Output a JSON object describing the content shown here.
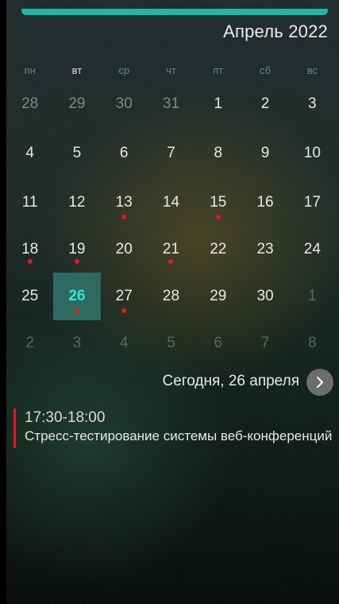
{
  "header": {
    "month_title": "Апрель 2022"
  },
  "accent_color": "#1fb8a8",
  "event_color": "#e01b22",
  "weekdays": [
    "пн",
    "вт",
    "ср",
    "чт",
    "пт",
    "сб",
    "вс"
  ],
  "weeks": [
    [
      {
        "day": "28",
        "state": "muted"
      },
      {
        "day": "29",
        "state": "muted"
      },
      {
        "day": "30",
        "state": "muted"
      },
      {
        "day": "31",
        "state": "muted"
      },
      {
        "day": "1"
      },
      {
        "day": "2"
      },
      {
        "day": "3"
      }
    ],
    [
      {
        "day": "4"
      },
      {
        "day": "5"
      },
      {
        "day": "6"
      },
      {
        "day": "7"
      },
      {
        "day": "8"
      },
      {
        "day": "9"
      },
      {
        "day": "10"
      }
    ],
    [
      {
        "day": "11"
      },
      {
        "day": "12"
      },
      {
        "day": "13",
        "event": true
      },
      {
        "day": "14"
      },
      {
        "day": "15",
        "event": true
      },
      {
        "day": "16"
      },
      {
        "day": "17"
      }
    ],
    [
      {
        "day": "18",
        "event": true
      },
      {
        "day": "19",
        "event": true
      },
      {
        "day": "20"
      },
      {
        "day": "21",
        "event": true
      },
      {
        "day": "22"
      },
      {
        "day": "23"
      },
      {
        "day": "24"
      }
    ],
    [
      {
        "day": "25"
      },
      {
        "day": "26",
        "event": true,
        "today": true
      },
      {
        "day": "27",
        "event": true
      },
      {
        "day": "28"
      },
      {
        "day": "29"
      },
      {
        "day": "30"
      },
      {
        "day": "1",
        "state": "other"
      }
    ],
    [
      {
        "day": "2",
        "state": "other"
      },
      {
        "day": "3",
        "state": "other"
      },
      {
        "day": "4",
        "state": "other"
      },
      {
        "day": "5",
        "state": "other"
      },
      {
        "day": "6",
        "state": "other"
      },
      {
        "day": "7",
        "state": "other"
      },
      {
        "day": "8",
        "state": "other"
      }
    ]
  ],
  "today_bar": {
    "label": "Сегодня, 26 апреля",
    "next_icon": "chevron-right-icon"
  },
  "event": {
    "time": "17:30-18:00",
    "title": "Стресс-тестирование системы веб-конференций"
  }
}
